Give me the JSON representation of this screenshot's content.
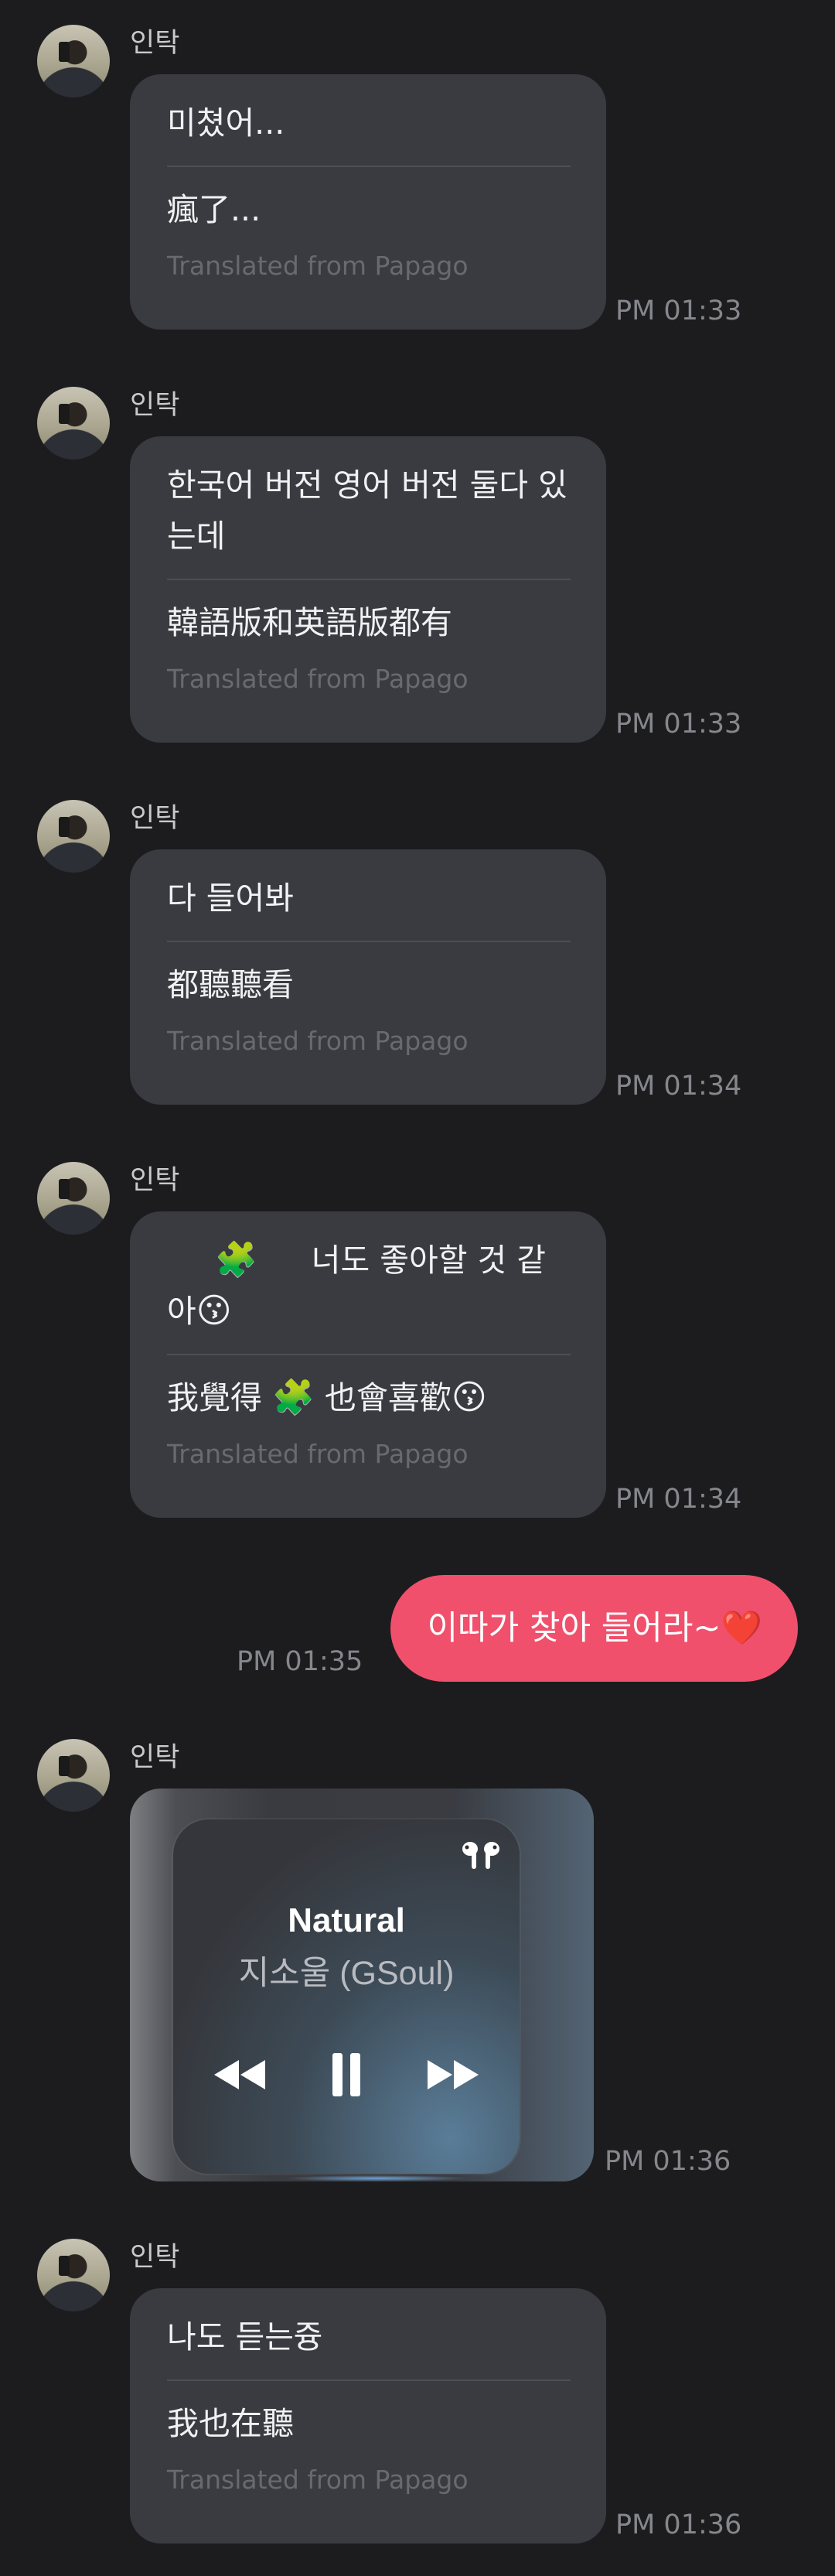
{
  "sender_name": "인탁",
  "papago_label": "Translated from Papago",
  "messages": [
    {
      "original": "미쳤어...",
      "translated": "瘋了...",
      "time": "PM 01:33"
    },
    {
      "original": "한국어 버전 영어 버전 둘다 있는데",
      "translated": "韓語版和英語版都有",
      "time": "PM 01:33"
    },
    {
      "original": "다 들어봐",
      "translated": "都聽聽看",
      "time": "PM 01:34"
    },
    {
      "original_text": "너도 좋아할 것 같아",
      "original_emoji": "😗",
      "translated_pre": "我覺得",
      "translated_post": "也會喜歡",
      "translated_emoji": "😗",
      "puzzle_emoji": "🧩",
      "time": "PM 01:34"
    },
    {
      "original": "나도 듣는즁",
      "translated": "我也在聽",
      "time": "PM 01:36"
    }
  ],
  "my_message": {
    "text": "이따가 찾아 들어라~",
    "emoji": "❤️",
    "time": "PM 01:35"
  },
  "music_card": {
    "song_title": "Natural",
    "artist": "지소울 (GSoul)",
    "time": "PM 01:36",
    "icons": [
      "airpods-icon",
      "rewind-icon",
      "pause-icon",
      "fast-forward-icon"
    ]
  },
  "colors": {
    "background": "#1c1c1f",
    "bubble": "#3a3b40",
    "my_bubble": "#f0506c",
    "timestamp": "#86878d"
  }
}
